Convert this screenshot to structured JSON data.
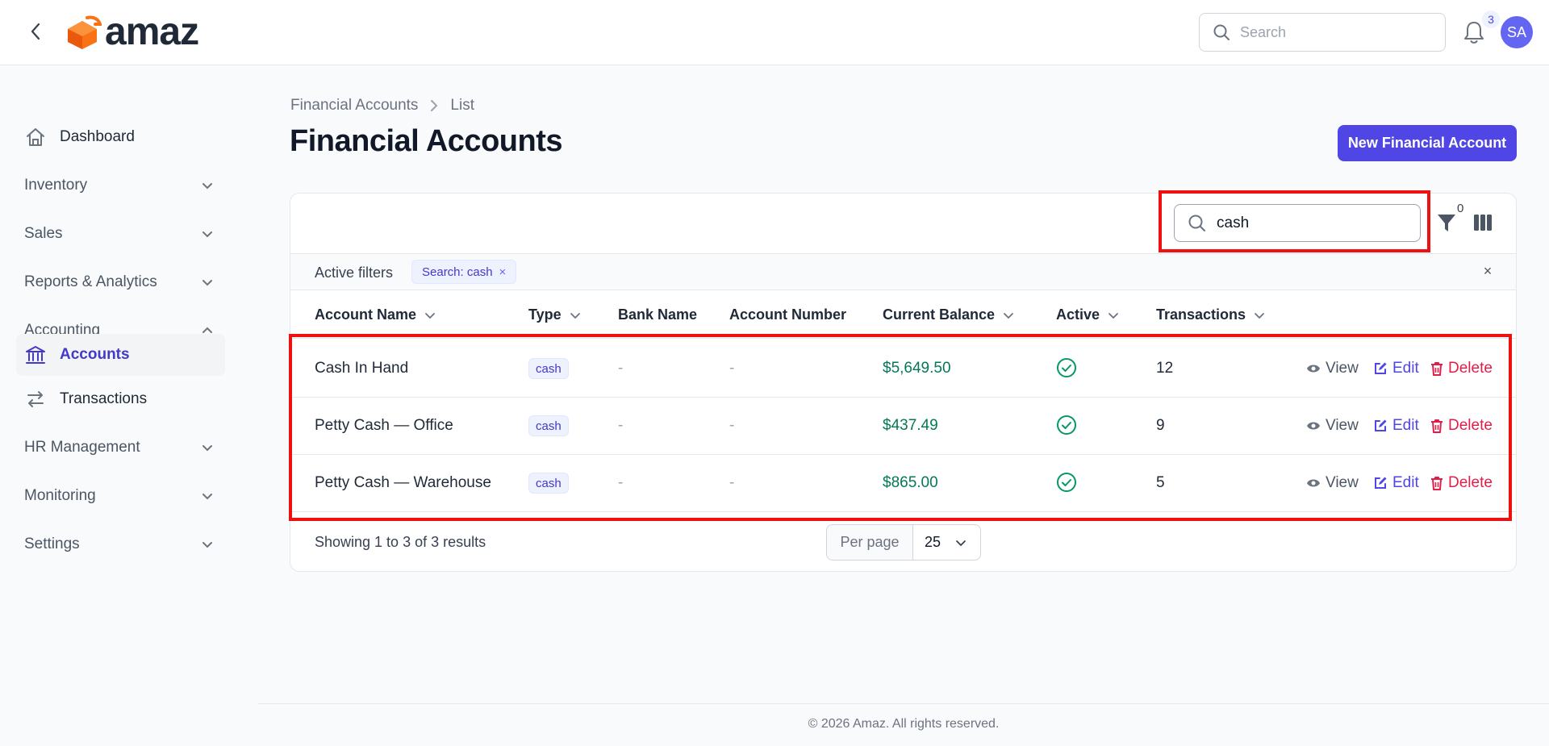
{
  "header": {
    "logo_text": "amaz",
    "search_placeholder": "Search",
    "notification_count": "3",
    "avatar_initials": "SA"
  },
  "sidebar": {
    "items": [
      {
        "label": "Dashboard"
      },
      {
        "label": "Inventory"
      },
      {
        "label": "Sales"
      },
      {
        "label": "Reports & Analytics"
      },
      {
        "label": "Accounting"
      },
      {
        "label": "Accounts"
      },
      {
        "label": "Transactions"
      },
      {
        "label": "HR Management"
      },
      {
        "label": "Monitoring"
      },
      {
        "label": "Settings"
      }
    ]
  },
  "breadcrumb": {
    "parent": "Financial Accounts",
    "current": "List"
  },
  "page": {
    "title": "Financial Accounts",
    "new_button": "New Financial Account"
  },
  "table_toolbar": {
    "search_value": "cash",
    "filter_count": "0"
  },
  "filters": {
    "label": "Active filters",
    "chip": "Search: cash",
    "chip_remove": "×",
    "clear": "×"
  },
  "table": {
    "columns": [
      "Account Name",
      "Type",
      "Bank Name",
      "Account Number",
      "Current Balance",
      "Active",
      "Transactions"
    ],
    "rows": [
      {
        "name": "Cash In Hand",
        "type": "cash",
        "bank": "-",
        "number": "-",
        "balance": "$5,649.50",
        "transactions": "12"
      },
      {
        "name": "Petty Cash — Office",
        "type": "cash",
        "bank": "-",
        "number": "-",
        "balance": "$437.49",
        "transactions": "9"
      },
      {
        "name": "Petty Cash — Warehouse",
        "type": "cash",
        "bank": "-",
        "number": "-",
        "balance": "$865.00",
        "transactions": "5"
      }
    ],
    "actions": {
      "view": "View",
      "edit": "Edit",
      "delete": "Delete"
    }
  },
  "pagination": {
    "showing": "Showing 1 to 3 of 3 results",
    "per_page_label": "Per page",
    "per_page_value": "25"
  },
  "footer": {
    "text": "© 2026 Amaz. All rights reserved."
  },
  "colors": {
    "accent": "#4f46e5",
    "success": "#059669",
    "danger": "#e11d48",
    "highlight": "#ef1111"
  }
}
